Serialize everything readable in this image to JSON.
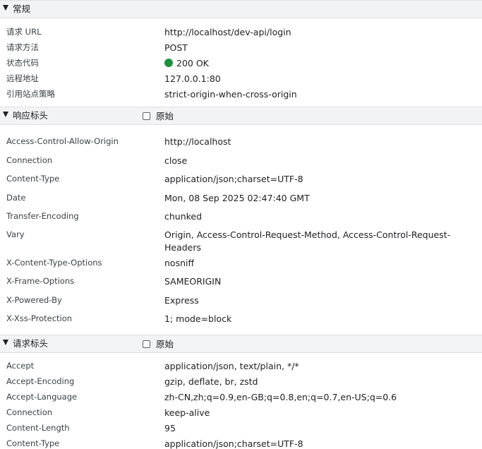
{
  "general": {
    "title": "常规",
    "rows": [
      {
        "key": "请求 URL",
        "value": "http://localhost/dev-api/login"
      },
      {
        "key": "请求方法",
        "value": "POST"
      },
      {
        "key": "状态代码",
        "value": "200 OK",
        "status_color": "#1e8e3e"
      },
      {
        "key": "远程地址",
        "value": "127.0.0.1:80"
      },
      {
        "key": "引用站点策略",
        "value": "strict-origin-when-cross-origin"
      }
    ]
  },
  "response_headers": {
    "title": "响应标头",
    "raw_label": "原始",
    "raw_checked": false,
    "rows": [
      {
        "key": "Access-Control-Allow-Origin",
        "value": "http://localhost"
      },
      {
        "key": "Connection",
        "value": "close"
      },
      {
        "key": "Content-Type",
        "value": "application/json;charset=UTF-8"
      },
      {
        "key": "Date",
        "value": "Mon, 08 Sep 2025 02:47:40 GMT"
      },
      {
        "key": "Transfer-Encoding",
        "value": "chunked"
      },
      {
        "key": "Vary",
        "value": "Origin, Access-Control-Request-Method, Access-Control-Request-Headers"
      },
      {
        "key": "X-Content-Type-Options",
        "value": "nosniff"
      },
      {
        "key": "X-Frame-Options",
        "value": "SAMEORIGIN"
      },
      {
        "key": "X-Powered-By",
        "value": "Express"
      },
      {
        "key": "X-Xss-Protection",
        "value": "1; mode=block"
      }
    ]
  },
  "request_headers": {
    "title": "请求标头",
    "raw_label": "原始",
    "raw_checked": false,
    "rows": [
      {
        "key": "Accept",
        "value": "application/json, text/plain, */*"
      },
      {
        "key": "Accept-Encoding",
        "value": "gzip, deflate, br, zstd"
      },
      {
        "key": "Accept-Language",
        "value": "zh-CN,zh;q=0.9,en-GB;q=0.8,en;q=0.7,en-US;q=0.6"
      },
      {
        "key": "Connection",
        "value": "keep-alive"
      },
      {
        "key": "Content-Length",
        "value": "95"
      },
      {
        "key": "Content-Type",
        "value": "application/json;charset=UTF-8"
      }
    ]
  }
}
